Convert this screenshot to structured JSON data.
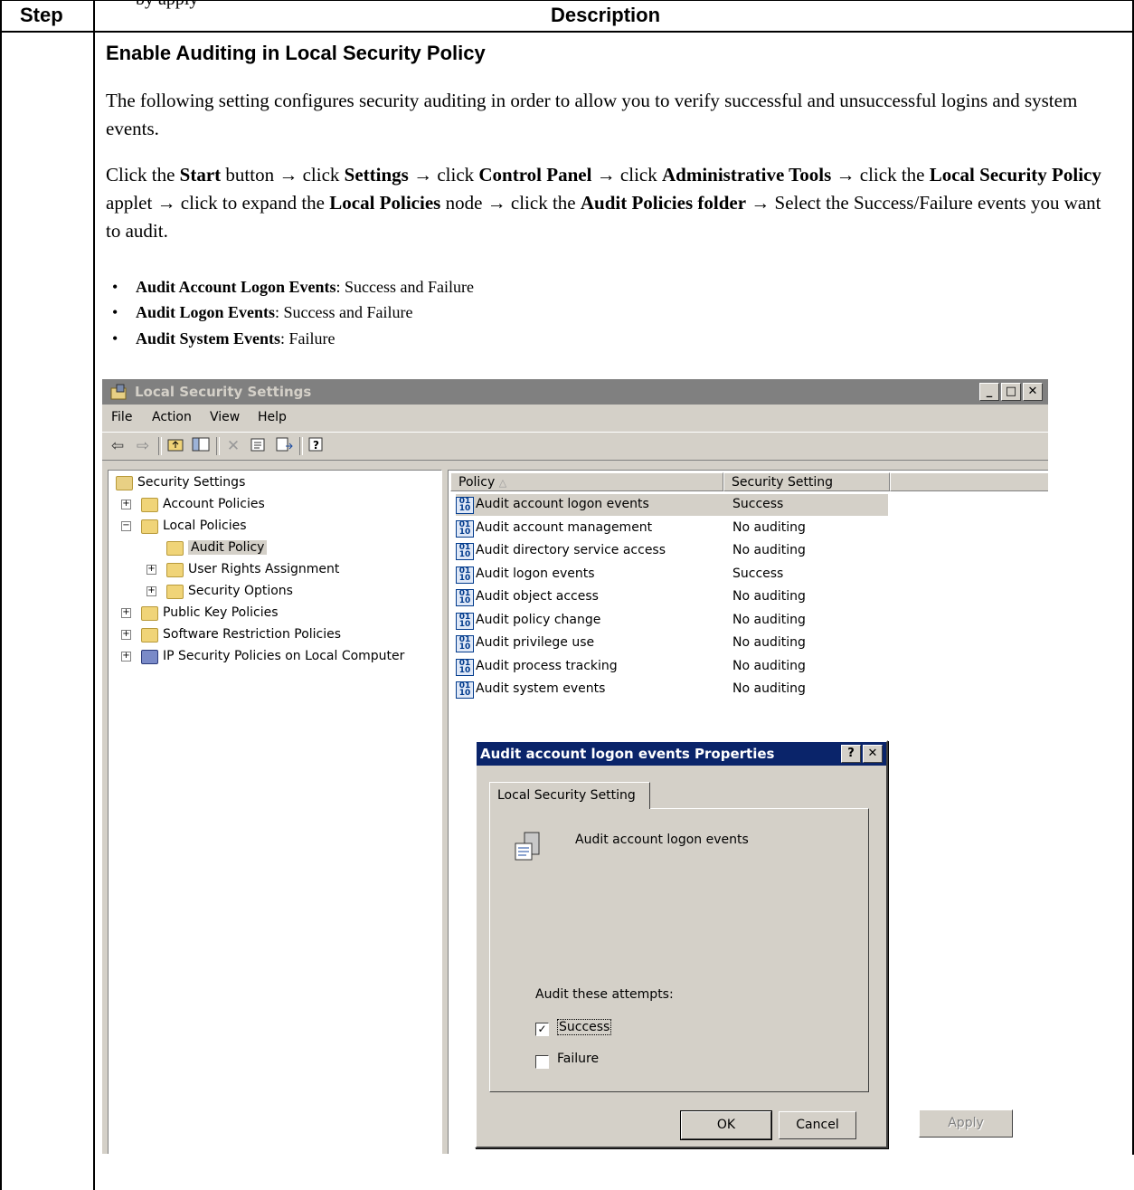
{
  "page": {
    "top_cut_text": "by                                                          apply",
    "header": {
      "step": "Step",
      "description": "Description"
    },
    "section_title": "Enable Auditing in Local Security Policy",
    "intro": "The following setting configures security auditing in order to allow you to verify successful and unsuccessful logins and system events.",
    "instructions": [
      {
        "t": "Click the ",
        "b": false
      },
      {
        "t": "Start",
        "b": true
      },
      {
        "t": " button → click ",
        "b": false
      },
      {
        "t": "Settings",
        "b": true
      },
      {
        "t": " → click ",
        "b": false
      },
      {
        "t": "Control Panel",
        "b": true
      },
      {
        "t": " → click ",
        "b": false
      },
      {
        "t": "Administrative Tools",
        "b": true
      },
      {
        "t": " → click the ",
        "b": false
      },
      {
        "t": "Local Security Policy",
        "b": true
      },
      {
        "t": " applet → click to expand the ",
        "b": false
      },
      {
        "t": "Local Policies",
        "b": true
      },
      {
        "t": " node → click the ",
        "b": false
      },
      {
        "t": "Audit Policies folder",
        "b": true
      },
      {
        "t": " → Select the Success/Failure events you want to audit.",
        "b": false
      }
    ],
    "bullets": [
      {
        "name": "Audit Account Logon Events",
        "value": ": Success and Failure"
      },
      {
        "name": "Audit Logon Events",
        "value": ": Success and Failure"
      },
      {
        "name": "Audit System Events",
        "value": ": Failure"
      }
    ]
  },
  "window": {
    "title": "Local Security Settings",
    "menu": [
      "File",
      "Action",
      "View",
      "Help"
    ],
    "tree": [
      {
        "label": "Security Settings"
      },
      {
        "label": "Account Policies"
      },
      {
        "label": "Local Policies"
      },
      {
        "label": "Audit Policy"
      },
      {
        "label": "User Rights Assignment"
      },
      {
        "label": "Security Options"
      },
      {
        "label": "Public Key Policies"
      },
      {
        "label": "Software Restriction Policies"
      },
      {
        "label": "IP Security Policies on Local Computer"
      }
    ],
    "columns": {
      "policy": "Policy",
      "setting": "Security Setting"
    },
    "policies": [
      {
        "name": "Audit account logon events",
        "setting": "Success"
      },
      {
        "name": "Audit account management",
        "setting": "No auditing"
      },
      {
        "name": "Audit directory service access",
        "setting": "No auditing"
      },
      {
        "name": "Audit logon events",
        "setting": "Success"
      },
      {
        "name": "Audit object access",
        "setting": "No auditing"
      },
      {
        "name": "Audit policy change",
        "setting": "No auditing"
      },
      {
        "name": "Audit privilege use",
        "setting": "No auditing"
      },
      {
        "name": "Audit process tracking",
        "setting": "No auditing"
      },
      {
        "name": "Audit system events",
        "setting": "No auditing"
      }
    ]
  },
  "dialog": {
    "title": "Audit account logon events Properties",
    "tab": "Local Security Setting",
    "policy_name": "Audit account logon events",
    "attempts_label": "Audit these attempts:",
    "success_label": "Success",
    "success_checked": true,
    "failure_label": "Failure",
    "failure_checked": false,
    "buttons": {
      "ok": "OK",
      "cancel": "Cancel",
      "apply": "Apply"
    }
  }
}
